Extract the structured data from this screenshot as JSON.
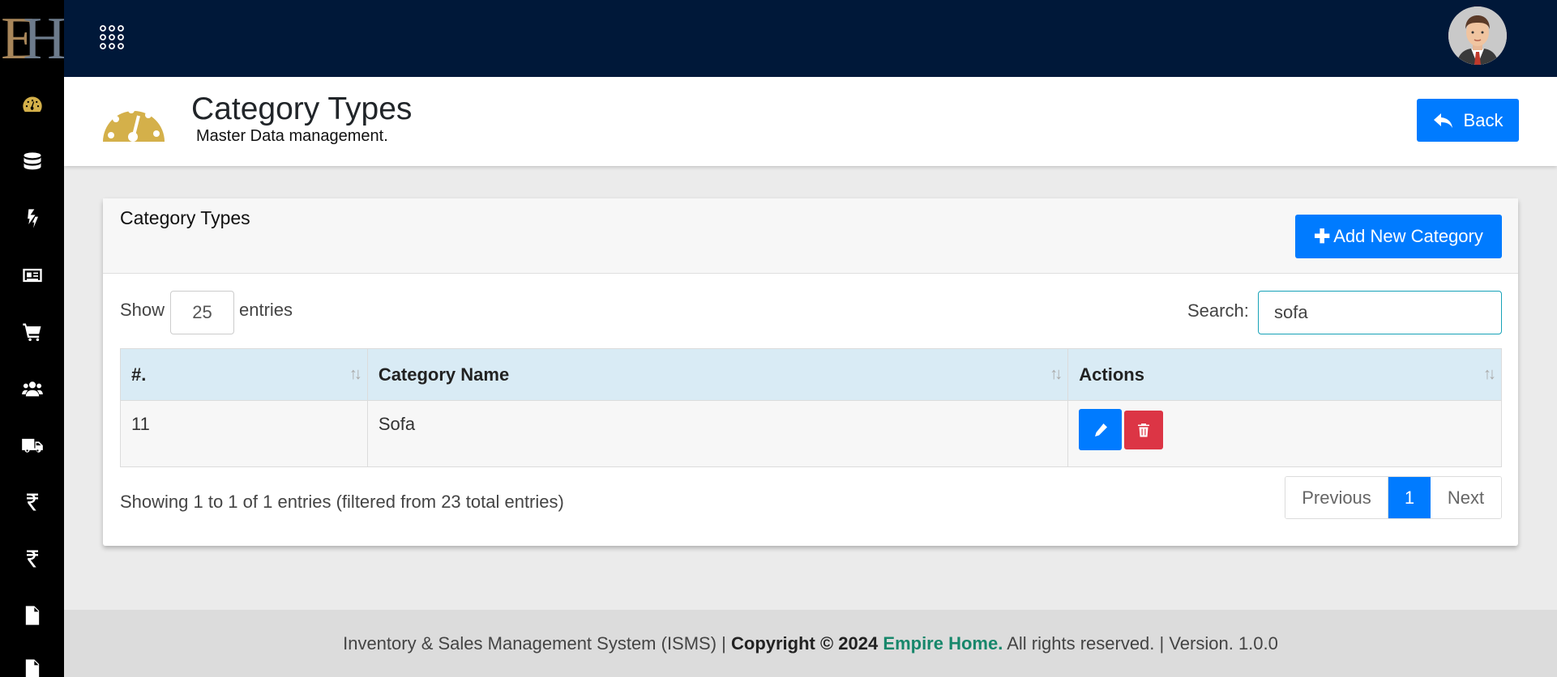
{
  "logo": {
    "letters_e": "E",
    "letters_h": "H"
  },
  "sidebar": {
    "items": [
      {
        "icon": "dashboard-icon"
      },
      {
        "icon": "database-icon"
      },
      {
        "icon": "bolt-icon"
      },
      {
        "icon": "id-card-icon"
      },
      {
        "icon": "cart-icon"
      },
      {
        "icon": "users-icon"
      },
      {
        "icon": "truck-icon"
      },
      {
        "icon": "rupee-icon"
      },
      {
        "icon": "rupee-icon"
      },
      {
        "icon": "file-icon"
      },
      {
        "icon": "file-icon"
      }
    ]
  },
  "header": {
    "title": "Category Types",
    "subtitle": "Master Data management.",
    "back_label": "Back"
  },
  "card": {
    "title": "Category Types",
    "add_label": "Add New Category",
    "show_label": "Show",
    "page_length": "25",
    "entries_label": "entries",
    "search_label": "Search:",
    "search_value": "sofa",
    "columns": [
      "#.",
      "Category Name",
      "Actions"
    ],
    "rows": [
      {
        "id": "11",
        "name": "Sofa"
      }
    ],
    "info": "Showing 1 to 1 of 1 entries (filtered from 23 total entries)",
    "pagination": {
      "previous": "Previous",
      "current": "1",
      "next": "Next"
    }
  },
  "footer": {
    "prefix": "Inventory & Sales Management System (ISMS) | ",
    "copyright": "Copyright © 2024",
    "brand": "Empire Home.",
    "suffix": " All rights reserved. | Version. 1.0.0"
  },
  "colors": {
    "sidebar_bg": "#000000",
    "topbar_bg": "#001839",
    "primary": "#007bff",
    "danger": "#dc3545",
    "accent_gold": "#d4b04a",
    "brand_green": "#17876b"
  }
}
